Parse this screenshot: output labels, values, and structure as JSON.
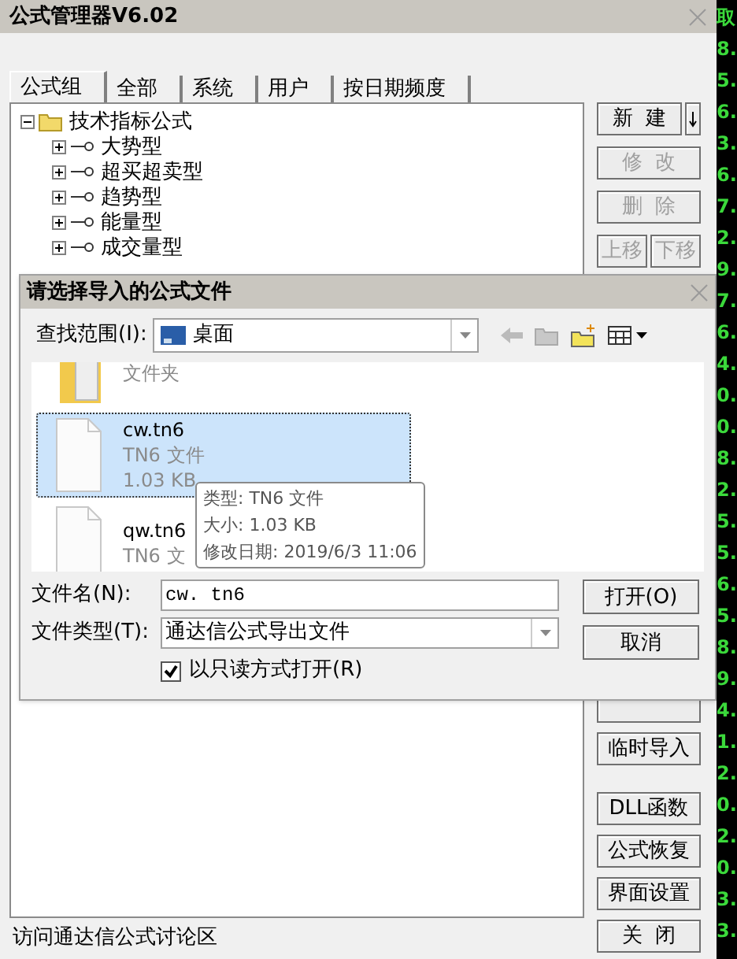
{
  "window": {
    "title": "公式管理器V6.02"
  },
  "tabs": [
    {
      "label": "公式组",
      "selected": true
    },
    {
      "label": "全部",
      "selected": false
    },
    {
      "label": "系统",
      "selected": false
    },
    {
      "label": "用户",
      "selected": false
    },
    {
      "label": "按日期频度",
      "selected": false
    }
  ],
  "tree": [
    {
      "label": "技术指标公式",
      "expanded": true,
      "children": [
        {
          "label": "大势型",
          "expanded": false
        },
        {
          "label": "超买超卖型",
          "expanded": false
        },
        {
          "label": "趋势型",
          "expanded": false
        },
        {
          "label": "能量型",
          "expanded": false
        },
        {
          "label": "成交量型",
          "expanded": false
        }
      ]
    }
  ],
  "side_buttons": [
    {
      "label": "新  建",
      "disabled": false
    },
    {
      "label": "修  改",
      "disabled": true
    },
    {
      "label": "删  除",
      "disabled": true
    },
    {
      "label": "上移",
      "disabled": true
    },
    {
      "label": "下移",
      "disabled": true
    },
    {
      "label": "临时导入",
      "disabled": false
    },
    {
      "label": "DLL函数",
      "disabled": false
    },
    {
      "label": "公式恢复",
      "disabled": false
    },
    {
      "label": "界面设置",
      "disabled": false
    },
    {
      "label": "关  闭",
      "disabled": false
    }
  ],
  "link": "访问通达信公式讨论区",
  "ticker": [
    "取",
    "8.",
    "5.",
    "6.",
    "3.",
    "6.",
    "7.",
    "2.",
    "9.",
    "7.",
    "6.",
    "4.",
    "0.",
    "0.",
    "8.",
    "2.",
    "5.",
    "5.",
    "6.",
    "5.",
    "8.",
    "9.",
    "4.",
    "1.",
    "2.",
    "0.",
    "2.",
    "0.",
    "3.",
    "3."
  ],
  "dialog": {
    "title": "请选择导入的公式文件",
    "look_in_label": "查找范围(I):",
    "look_in_value": "桌面",
    "files": [
      {
        "type": "文件夹",
        "kind": "folder",
        "selected": false
      },
      {
        "name": "cw.tn6",
        "type": "TN6 文件",
        "size": "1.03 KB",
        "kind": "file",
        "selected": true
      },
      {
        "name": "qw.tn6",
        "type": "TN6 文",
        "kind": "file",
        "selected": false
      }
    ],
    "tooltip": [
      "类型: TN6 文件",
      "大小: 1.03 KB",
      "修改日期: 2019/6/3 11:06"
    ],
    "file_name_label": "文件名(N):",
    "file_name": "cw. tn6",
    "file_type_label": "文件类型(T):",
    "file_type": "通达信公式导出文件",
    "readonly": {
      "label": "以只读方式打开(R)",
      "checked": true
    },
    "buttons": [
      "打开(O)",
      "取消"
    ]
  }
}
